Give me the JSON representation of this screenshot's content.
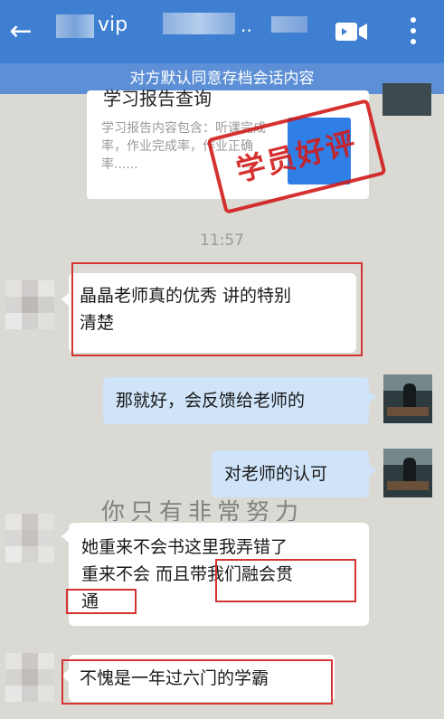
{
  "header": {
    "back_glyph": "←",
    "title_fragment": "vip",
    "title_tail": "..",
    "video_icon": "video-call-icon",
    "more_icon": "more-vertical-icon",
    "bg_color": "#3f7fd1"
  },
  "banner": {
    "text": "对方默认同意存档会话内容"
  },
  "card": {
    "title": "学习报告查询",
    "description": "学习报告内容包含：听课完成率，作业完成率，作业正确率......",
    "stamp_text": "学员好评",
    "stamp_color": "#d21b1b"
  },
  "timestamp": "11:57",
  "messages": [
    {
      "side": "left",
      "text_line1": "晶晶老师真的优秀 讲的特别",
      "text_line2": "清楚"
    },
    {
      "side": "right",
      "text": "那就好，会反馈给老师的"
    },
    {
      "side": "right",
      "text": "对老师的认可"
    },
    {
      "side": "left",
      "text_line1": "她重来不会书这里我弄错了",
      "text_line2_a": "重来不会 而且",
      "text_line2_b": "带我们融会贯",
      "text_line3": "通"
    },
    {
      "side": "left",
      "text": "不愧是一年过六门的学霸"
    }
  ],
  "handwriting": "你只有非常努力",
  "highlight_color": "#d63333"
}
